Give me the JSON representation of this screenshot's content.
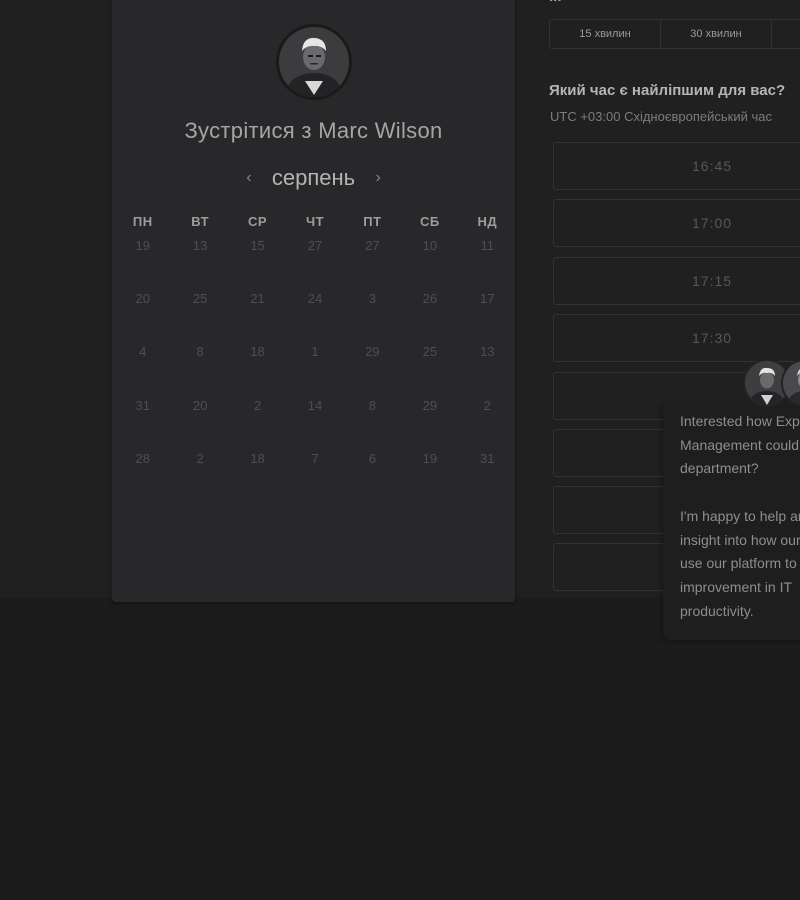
{
  "top_cut_text": "...",
  "host": {
    "title_prefix": "Зустрітися з",
    "name": "Marc Wilson"
  },
  "calendar": {
    "month": "серпень",
    "prev_icon": "chevron-left-icon",
    "next_icon": "chevron-right-icon",
    "weekdays": [
      "ПН",
      "ВТ",
      "СР",
      "ЧТ",
      "ПТ",
      "СБ",
      "НД"
    ],
    "weeks": [
      [
        "19",
        "13",
        "15",
        "27",
        "27",
        "10",
        "11"
      ],
      [
        "20",
        "25",
        "21",
        "24",
        "3",
        "26",
        "17"
      ],
      [
        "4",
        "8",
        "18",
        "1",
        "29",
        "25",
        "13"
      ],
      [
        "31",
        "20",
        "2",
        "14",
        "8",
        "29",
        "2"
      ],
      [
        "28",
        "2",
        "18",
        "7",
        "6",
        "19",
        "31"
      ]
    ]
  },
  "durations": [
    "15 хвилин",
    "30 хвилин",
    ""
  ],
  "time_question": "Який час є найліпшим для вас?",
  "timezone": "UTC +03:00 Східноєвропейський час",
  "slots": [
    "16:45",
    "17:00",
    "17:15",
    "17:30",
    "",
    "",
    "",
    ""
  ],
  "chat": {
    "lines_p1": [
      "Interested how Expert",
      "Management could",
      "department?"
    ],
    "lines_p2": [
      "I'm happy to help and",
      "insight into how our",
      "use our platform to",
      "improvement in IT",
      "productivity."
    ]
  },
  "colors": {
    "background": "#1c1c1d",
    "card": "#28282a",
    "text_primary": "#b4b4b4",
    "text_muted": "#4f4f52"
  }
}
